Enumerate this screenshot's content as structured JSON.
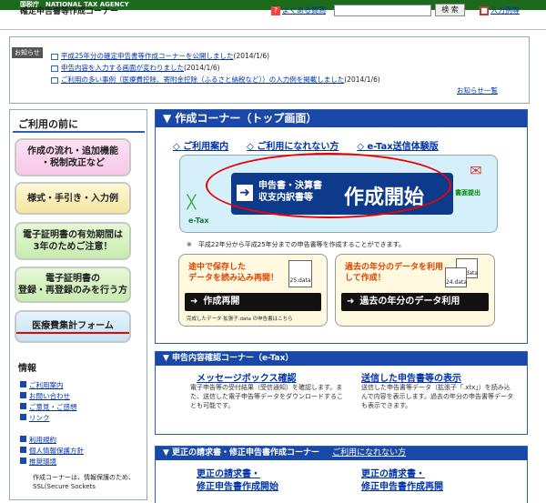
{
  "topbar": {
    "agency": "国税庁　NATIONAL TAX AGENCY"
  },
  "header": {
    "title": "確定申告書等作成コーナー",
    "faq": "よくある質問",
    "search_button": "検 索",
    "example": "入力例等"
  },
  "notice": {
    "tag": "お知らせ",
    "items": [
      {
        "text": "平成25年分の確定申告書等作成コーナーを公開しました",
        "date": "(2014/1/6)"
      },
      {
        "text": "申告内容を入力する画面が変わりました",
        "date": "(2014/1/6)"
      },
      {
        "text": "ご利用の多い事例（医療費控除、寄附金控除（ふるさと納税など））の入力例を掲載しました",
        "date": "(2014/1/6)"
      }
    ],
    "more": "お知らせ一覧"
  },
  "sidebar": {
    "heading": "ご利用の前に",
    "boxes": [
      {
        "line1": "作成の流れ・追加機能",
        "line2": "・税制改正など"
      },
      {
        "line1": "様式・手引き・入力例",
        "line2": ""
      },
      {
        "line1": "電子証明書の有効期間は",
        "line2": "3年のためご注意！"
      },
      {
        "line1": "電子証明書の",
        "line2": "登録・再登録のみを行う方"
      },
      {
        "line1": "医療費集計フォーム",
        "line2": ""
      }
    ],
    "info_heading": "情報",
    "links": [
      "ご利用案内",
      "お問い合わせ",
      "ご意見・ご感想",
      "リンク"
    ],
    "links2": [
      "利用規約",
      "個人情報保護方針",
      "推奨環境"
    ],
    "footer_text": "作成コーナーは、情報保護のため、SSL(Secure Sockets"
  },
  "main": {
    "title": "▼ 作成コーナー（トップ画面）",
    "links": [
      "ご利用案内",
      "ご利用になれない方",
      "e-Tax送信体験版"
    ],
    "big_button": {
      "line1": "申告書・決算書",
      "line2": "収支内訳書等",
      "main": "作成開始"
    },
    "etax": "e-Tax",
    "submit_label": "書面提出",
    "note": "※　平成22年分から平成25年分までの申告書等を作成することができます。",
    "resume": {
      "text1": "途中で保存した",
      "text2": "データを読み込み再開！",
      "button": "作成再開",
      "file": "25.data",
      "small": "完成したデータ 拡張子.data の申告書はこちら"
    },
    "past": {
      "text1": "過去の年分のデータを利用",
      "text2": "して作成！",
      "button": "過去の年分のデータ利用",
      "file1": "25.data",
      "file2": "24.data"
    }
  },
  "confirm": {
    "title": "▼ 申告内容確認コーナー（e-Tax）",
    "col1": {
      "heading": "メッセージボックス確認",
      "text": "電子申告等の受付結果（受信通知）を確認します。また、送信した電子申告等データをダウンロードすることも可能です。"
    },
    "col2": {
      "heading": "送信した申告書等の表示",
      "text": "送信した申告書等データ（拡張子「.xtx」）を読み込んで内容を表示します。過去の年分の申告書等データも表示できます。"
    }
  },
  "correction": {
    "title": "▼ 更正の請求書・修正申告書作成コーナー",
    "link": "ご利用になれない方",
    "col1": {
      "line1": "更正の請求書・",
      "line2": "修正申告書作成開始"
    },
    "col2": {
      "line1": "更正の請求書・",
      "line2": "修正申告書作成再開"
    }
  }
}
